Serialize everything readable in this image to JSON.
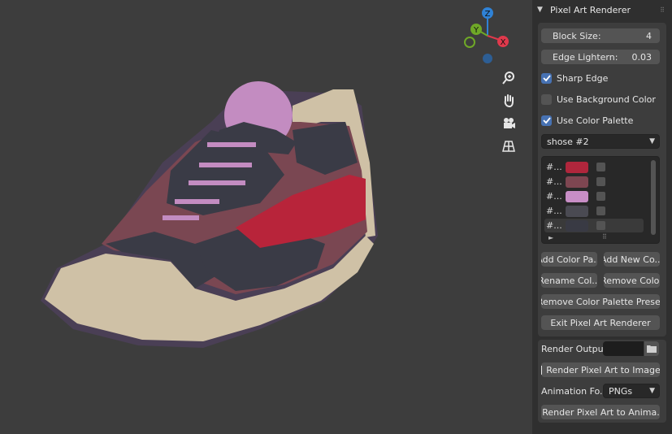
{
  "panel": {
    "title": "Pixel Art Renderer",
    "block_size": {
      "label": "Block Size:",
      "value": "4"
    },
    "edge_lighten": {
      "label": "Edge Lightern:",
      "value": "0.03"
    },
    "sharp_edge": {
      "label": "Sharp Edge",
      "checked": true
    },
    "use_bg_color": {
      "label": "Use Background Color",
      "checked": false
    },
    "use_palette": {
      "label": "Use Color Palette",
      "checked": true
    },
    "palette_select": "shose #2",
    "palette": [
      {
        "hex": "#...",
        "color": "#b0263c"
      },
      {
        "hex": "#...",
        "color": "#7e4651"
      },
      {
        "hex": "#...",
        "color": "#c88ec6"
      },
      {
        "hex": "#...",
        "color": "#4a4a52"
      },
      {
        "hex": "#...",
        "color": "#393a44"
      }
    ],
    "buttons": {
      "add_color_palette": "Add Color Pa...",
      "add_new_color": "Add New Co...",
      "rename_color": "Rename Col...",
      "remove_color": "Remove Color",
      "remove_preset": "Remove Color Palette Preset",
      "exit": "Exit Pixel Art Renderer"
    },
    "render_output_label": "Render Output:",
    "render_image": "Render Pixel Art to Image",
    "animation_format_label": "Animation Fo...",
    "animation_format_value": "PNGs",
    "render_animation": "Render Pixel Art to Anima..."
  },
  "gizmo": {
    "z": "Z",
    "y": "Y",
    "x": "X",
    "colors": {
      "x": "#e0394c",
      "y": "#6fa827",
      "z": "#2f82d6"
    }
  },
  "scene_colors": {
    "sole": "#cfc1a6",
    "dark": "#3a3b46",
    "mid": "#7a4752",
    "pink": "#c38cc1",
    "red": "#b8243a",
    "bg": "#3d3d3d"
  }
}
